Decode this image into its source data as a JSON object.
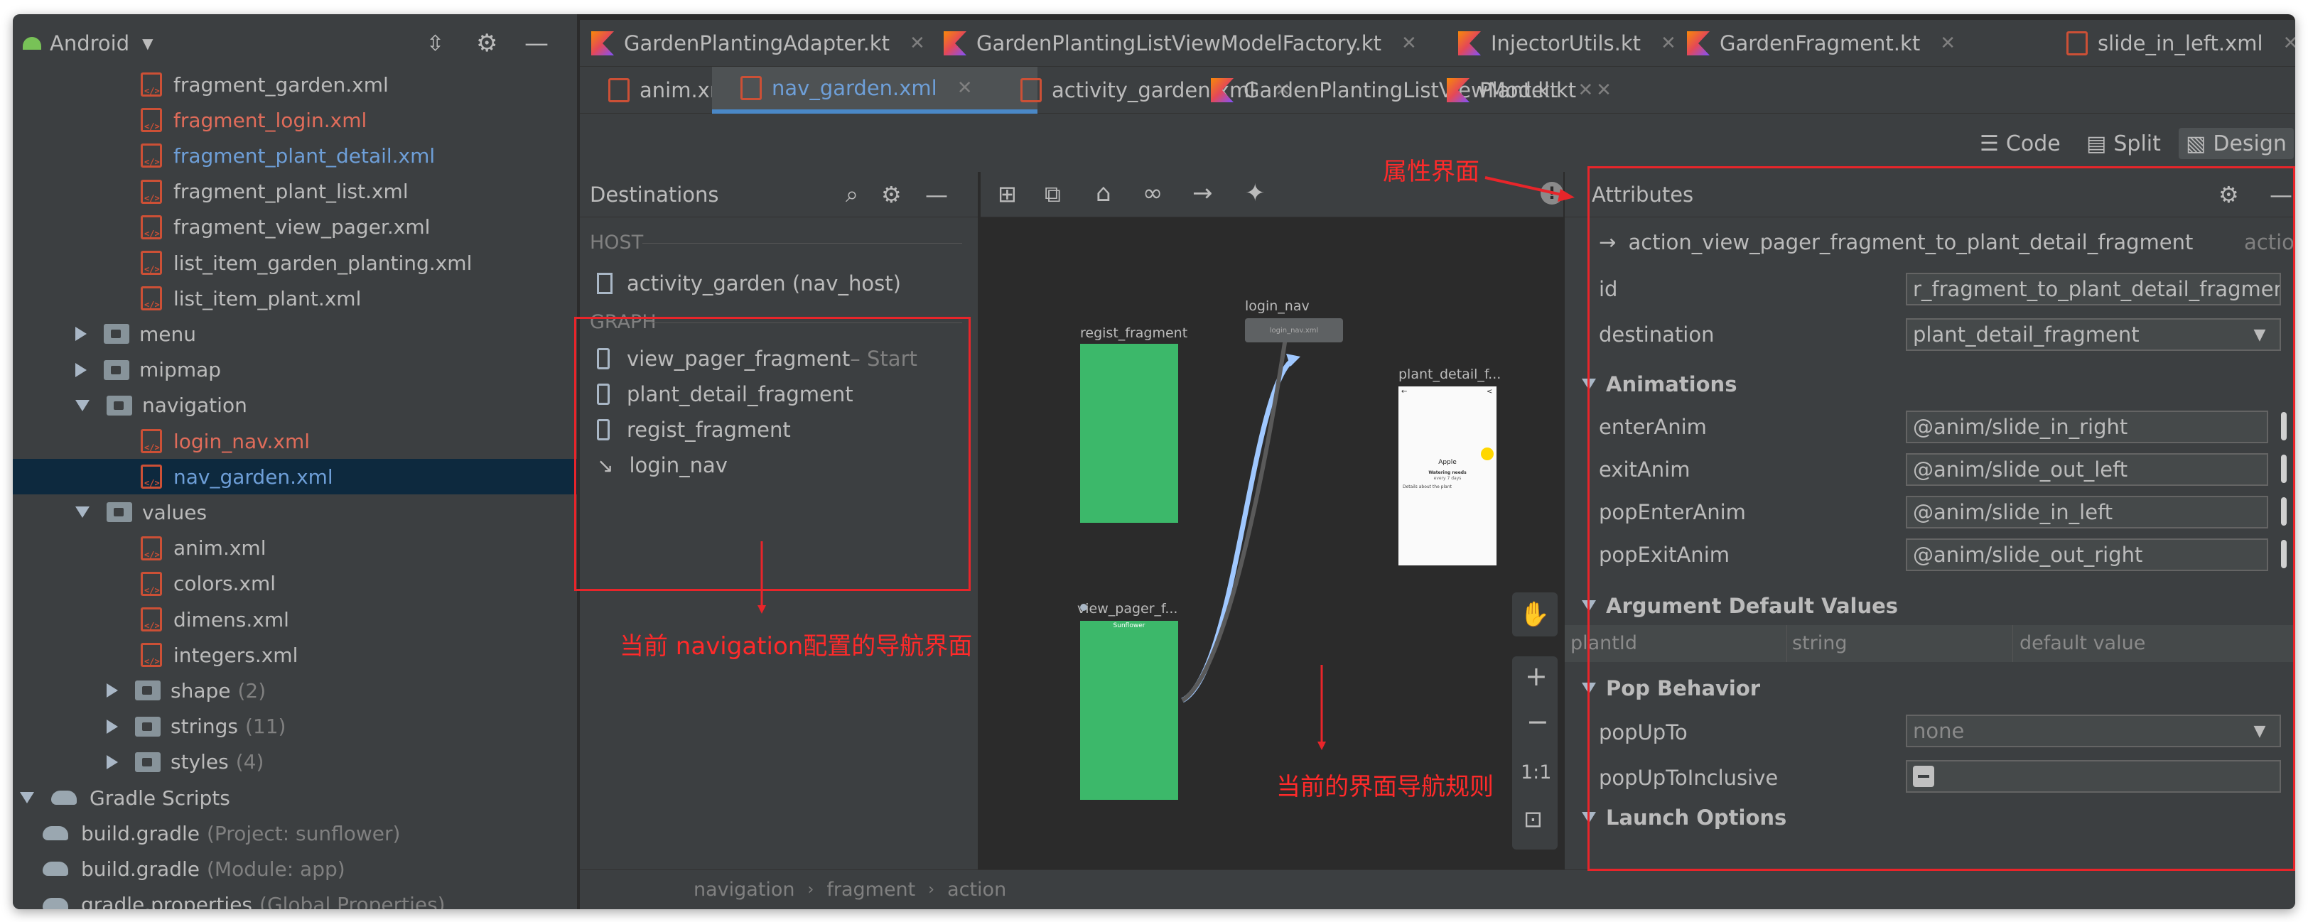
{
  "project": {
    "title": "Android",
    "tree": [
      {
        "label": "fragment_garden.xml",
        "kind": "xml",
        "color": "#bbbbbb",
        "indent": 4,
        "sel": false
      },
      {
        "label": "fragment_login.xml",
        "kind": "xml",
        "color": "#e06c5a",
        "indent": 4,
        "sel": false
      },
      {
        "label": "fragment_plant_detail.xml",
        "kind": "xml",
        "color": "#6e9fd8",
        "indent": 4,
        "sel": false
      },
      {
        "label": "fragment_plant_list.xml",
        "kind": "xml",
        "color": "#bbbbbb",
        "indent": 4,
        "sel": false
      },
      {
        "label": "fragment_view_pager.xml",
        "kind": "xml",
        "color": "#bbbbbb",
        "indent": 4,
        "sel": false
      },
      {
        "label": "list_item_garden_planting.xml",
        "kind": "xml",
        "color": "#bbbbbb",
        "indent": 4,
        "sel": false
      },
      {
        "label": "list_item_plant.xml",
        "kind": "xml",
        "color": "#bbbbbb",
        "indent": 4,
        "sel": false
      },
      {
        "label": "menu",
        "kind": "folder",
        "expand": "r",
        "color": "#bbbbbb",
        "indent": 2,
        "sel": false
      },
      {
        "label": "mipmap",
        "kind": "folder",
        "expand": "r",
        "color": "#bbbbbb",
        "indent": 2,
        "sel": false
      },
      {
        "label": "navigation",
        "kind": "folder",
        "expand": "d",
        "color": "#bbbbbb",
        "indent": 2,
        "sel": false
      },
      {
        "label": "login_nav.xml",
        "kind": "xml",
        "color": "#e06c5a",
        "indent": 4,
        "sel": false
      },
      {
        "label": "nav_garden.xml",
        "kind": "xml",
        "color": "#6e9fd8",
        "indent": 4,
        "sel": true
      },
      {
        "label": "values",
        "kind": "folder",
        "expand": "d",
        "color": "#bbbbbb",
        "indent": 2,
        "sel": false
      },
      {
        "label": "anim.xml",
        "kind": "xml",
        "color": "#bbbbbb",
        "indent": 4,
        "sel": false
      },
      {
        "label": "colors.xml",
        "kind": "xml",
        "color": "#bbbbbb",
        "indent": 4,
        "sel": false
      },
      {
        "label": "dimens.xml",
        "kind": "xml",
        "color": "#bbbbbb",
        "indent": 4,
        "sel": false
      },
      {
        "label": "integers.xml",
        "kind": "xml",
        "color": "#bbbbbb",
        "indent": 4,
        "sel": false
      },
      {
        "label": "shape",
        "kind": "folder",
        "expand": "r",
        "count": "(2)",
        "color": "#bbbbbb",
        "indent": 3,
        "sel": false
      },
      {
        "label": "strings",
        "kind": "folder",
        "expand": "r",
        "count": "(11)",
        "color": "#bbbbbb",
        "indent": 3,
        "sel": false
      },
      {
        "label": "styles",
        "kind": "folder",
        "expand": "r",
        "count": "(4)",
        "color": "#bbbbbb",
        "indent": 3,
        "sel": false
      },
      {
        "label": "Gradle Scripts",
        "kind": "gradle",
        "expand": "d",
        "color": "#bbbbbb",
        "indent": 0,
        "sel": false
      },
      {
        "label": "build.gradle",
        "kind": "gradle",
        "count": "(Project: sunflower)",
        "color": "#bbbbbb",
        "indent": 1,
        "sel": false
      },
      {
        "label": "build.gradle",
        "kind": "gradle",
        "count": "(Module: app)",
        "color": "#bbbbbb",
        "indent": 1,
        "sel": false
      },
      {
        "label": "gradle.properties",
        "kind": "gradle",
        "count": "(Global Properties)",
        "color": "#bbbbbb",
        "indent": 1,
        "sel": false
      }
    ]
  },
  "tabs_row1": [
    {
      "label": "GardenPlantingAdapter.kt",
      "icon": "kotlin-file-icon"
    },
    {
      "label": "GardenPlantingListViewModelFactory.kt",
      "icon": "kotlin-class-icon"
    },
    {
      "label": "InjectorUtils.kt",
      "icon": "kotlin-class-icon"
    },
    {
      "label": "GardenFragment.kt",
      "icon": "kotlin-class-icon"
    },
    {
      "label": "slide_in_left.xml",
      "icon": "xml-file-icon"
    }
  ],
  "tabs_row2": [
    {
      "label": "anim.xml",
      "icon": "xml-file-icon"
    },
    {
      "label": "nav_garden.xml",
      "icon": "xml-file-icon",
      "active": true
    },
    {
      "label": "activity_garden.xml",
      "icon": "xml-file-icon"
    },
    {
      "label": "GardenPlantingListViewModel.kt",
      "icon": "kotlin-class-icon"
    },
    {
      "label": "Plant.kt",
      "icon": "kotlin-class-icon"
    }
  ],
  "view_modes": {
    "code": "Code",
    "split": "Split",
    "design": "Design"
  },
  "destinations": {
    "title": "Destinations",
    "host_label": "HOST",
    "host_item": "activity_garden (nav_host)",
    "graph_label": "GRAPH",
    "items": [
      {
        "label": "view_pager_fragment",
        "suffix": " – Start",
        "icon": "phone-icon"
      },
      {
        "label": "plant_detail_fragment",
        "icon": "phone-icon"
      },
      {
        "label": "regist_fragment",
        "icon": "phone-icon"
      },
      {
        "label": "login_nav",
        "icon": "nested-graph-icon"
      }
    ]
  },
  "canvas": {
    "regist_label": "regist_fragment",
    "login_nav_label": "login_nav",
    "login_nav_inner": "login_nav.xml",
    "plant_detail_label": "plant_detail_f...",
    "view_pager_label": "view_pager_f...",
    "view_pager_inner": "Sunflower",
    "plant_detail_preview_title": "Apple",
    "plant_detail_preview_sub": "Watering needs",
    "plant_detail_preview_sub2": "every 7 days",
    "plant_detail_preview_text": "Details about the plant",
    "zoom_label": "1:1"
  },
  "attributes": {
    "title": "Attributes",
    "action_name": "action_view_pager_fragment_to_plant_detail_fragment",
    "action_type": "action",
    "id_label": "id",
    "id_value": "r_fragment_to_plant_detail_fragment",
    "destination_label": "destination",
    "destination_value": "plant_detail_fragment",
    "animations_label": "Animations",
    "anims": [
      {
        "label": "enterAnim",
        "value": "@anim/slide_in_right"
      },
      {
        "label": "exitAnim",
        "value": "@anim/slide_out_left"
      },
      {
        "label": "popEnterAnim",
        "value": "@anim/slide_in_left"
      },
      {
        "label": "popExitAnim",
        "value": "@anim/slide_out_right"
      }
    ],
    "args_label": "Argument Default Values",
    "args_cols": [
      "plantId",
      "string",
      "default value"
    ],
    "pop_label": "Pop Behavior",
    "popupto_label": "popUpTo",
    "popupto_value": "none",
    "popupto_incl_label": "popUpToInclusive",
    "launch_label": "Launch Options"
  },
  "status": {
    "crumbs": [
      "navigation",
      "fragment",
      "action"
    ]
  },
  "annotations": {
    "attrs": "属性界面",
    "nav": "当前 navigation配置的导航界面",
    "rules": "当前的界面导航规则"
  }
}
